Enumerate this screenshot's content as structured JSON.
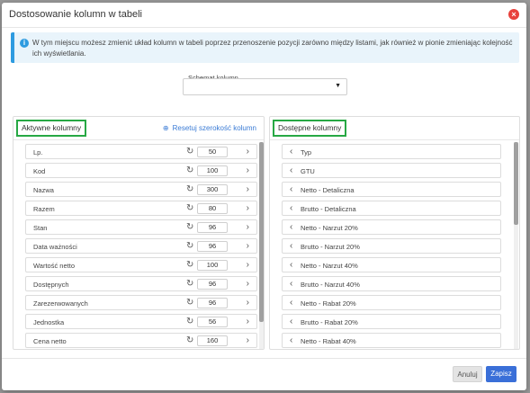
{
  "modal": {
    "title": "Dostosowanie kolumn w tabeli",
    "close_label": "×"
  },
  "info": {
    "text": "W tym miejscu możesz zmienić układ kolumn w tabeli poprzez przenoszenie pozycji zarówno między listami, jak również w pionie zmieniając kolejność ich wyświetlania."
  },
  "schema": {
    "label": "Schemat kolumn",
    "value": ""
  },
  "left_panel": {
    "title": "Aktywne kolumny",
    "reset_label": "Resetuj szerokość kolumn",
    "items": [
      {
        "name": "Lp.",
        "width": "50"
      },
      {
        "name": "Kod",
        "width": "100"
      },
      {
        "name": "Nazwa",
        "width": "300"
      },
      {
        "name": "Razem",
        "width": "80"
      },
      {
        "name": "Stan",
        "width": "96"
      },
      {
        "name": "Data ważności",
        "width": "96"
      },
      {
        "name": "Wartość netto",
        "width": "100"
      },
      {
        "name": "Dostępnych",
        "width": "96"
      },
      {
        "name": "Zarezerwowanych",
        "width": "96"
      },
      {
        "name": "Jednostka",
        "width": "56"
      },
      {
        "name": "Cena netto",
        "width": "160"
      }
    ]
  },
  "right_panel": {
    "title": "Dostępne kolumny",
    "items": [
      "Typ",
      "GTU",
      "Netto - Detaliczna",
      "Brutto - Detaliczna",
      "Netto - Narzut 20%",
      "Brutto - Narzut 20%",
      "Netto - Narzut 40%",
      "Brutto - Narzut 40%",
      "Netto - Rabat 20%",
      "Brutto - Rabat 20%",
      "Netto - Rabat 40%"
    ]
  },
  "footer": {
    "cancel_label": "Anuluj",
    "save_label": "Zapisz"
  },
  "icons": {
    "refresh": "↻",
    "chevron_right": "›",
    "chevron_left": "‹",
    "reset": "⊕",
    "info": "i",
    "caret_down": "▼"
  },
  "colors": {
    "accent": "#3a6fd8",
    "highlight_border": "#27a844",
    "close": "#e8413c",
    "info_bg": "#e9f4fb"
  }
}
